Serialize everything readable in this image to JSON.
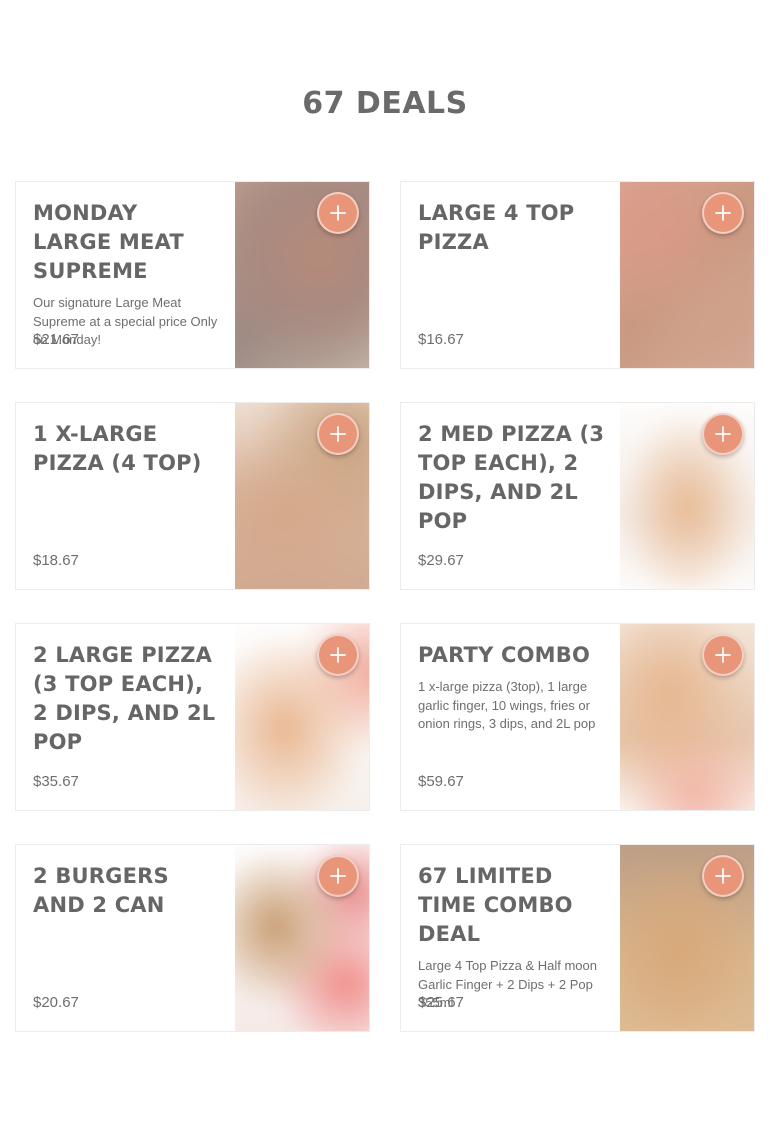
{
  "page": {
    "title": "67 DEALS"
  },
  "deals": [
    {
      "title": "MONDAY LARGE MEAT SUPREME",
      "description": "Our signature Large Meat Supreme at a special price Only on Monday!",
      "price": "$21.67",
      "add_label": "+"
    },
    {
      "title": "LARGE 4 TOP PIZZA",
      "description": "",
      "price": "$16.67",
      "add_label": "+"
    },
    {
      "title": "1 X-LARGE PIZZA (4 TOP)",
      "description": "",
      "price": "$18.67",
      "add_label": "+"
    },
    {
      "title": "2 MED PIZZA (3 TOP EACH), 2 DIPS, AND 2L POP",
      "description": "",
      "price": "$29.67",
      "add_label": "+"
    },
    {
      "title": "2 LARGE PIZZA (3 TOP EACH), 2 DIPS, AND 2L POP",
      "description": "",
      "price": "$35.67",
      "add_label": "+"
    },
    {
      "title": "PARTY COMBO",
      "description": "1 x-large pizza (3top), 1 large garlic finger, 10 wings, fries or onion rings, 3 dips, and 2L pop",
      "price": "$59.67",
      "add_label": "+"
    },
    {
      "title": "2 BURGERS AND 2 CAN",
      "description": "",
      "price": "$20.67",
      "add_label": "+"
    },
    {
      "title": "67 LIMITED TIME COMBO DEAL",
      "description": "Large 4 Top Pizza & Half moon Garlic Finger + 2 Dips + 2 Pop 355ml",
      "price": "$25.67",
      "add_label": "+"
    }
  ],
  "colors": {
    "accent": "#e8957a",
    "text": "#666666",
    "border": "#ececec"
  },
  "icons": {
    "add": "plus-icon"
  }
}
